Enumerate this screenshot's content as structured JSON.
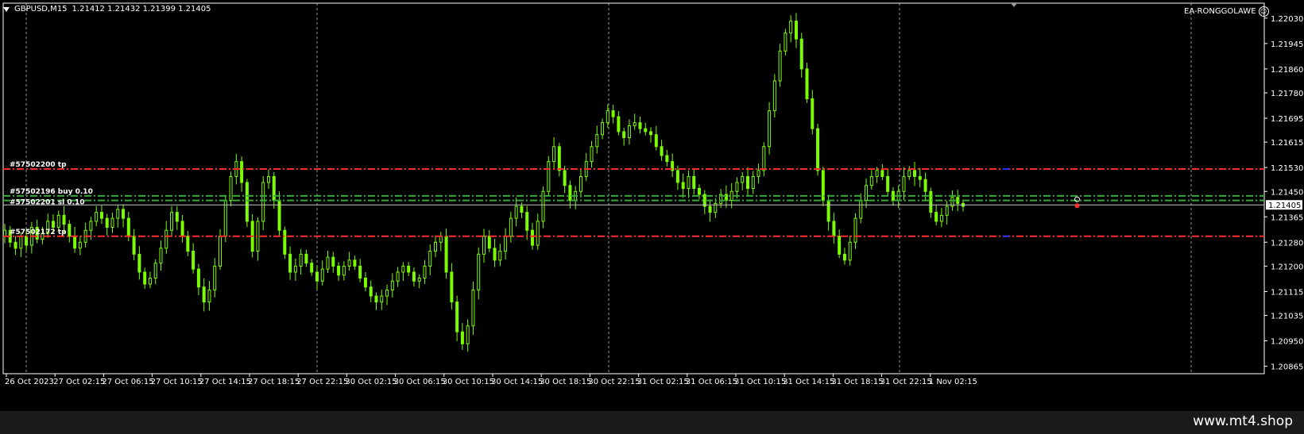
{
  "header": {
    "symbol": "GBPUSD,M15",
    "ohlc": "1.21412 1.21432 1.21399 1.21405",
    "ea_name": "EA-RONGGOLAWE",
    "ea_icon": "smiley-icon"
  },
  "footer": {
    "brand": "www.mt4.shop"
  },
  "colors": {
    "background": "#000000",
    "candle": "#7CFC00",
    "grid": "#c0c0c0",
    "tp_line": "#ff2a2a",
    "order_line": "#3aa83a",
    "current_price_line": "#c8c8c8",
    "axis_text": "#ffffff"
  },
  "chart_data": {
    "type": "candlestick",
    "ylim": [
      1.2084,
      1.2208
    ],
    "y_ticks": [
      "1.22030",
      "1.21945",
      "1.21860",
      "1.21780",
      "1.21695",
      "1.21615",
      "1.21530",
      "1.21450",
      "1.21365",
      "1.21280",
      "1.21200",
      "1.21115",
      "1.21035",
      "1.20950",
      "1.20865"
    ],
    "current_price": "1.21405",
    "x_ticks": [
      "26 Oct 2023",
      "27 Oct 02:15",
      "27 Oct 06:15",
      "27 Oct 10:15",
      "27 Oct 14:15",
      "27 Oct 18:15",
      "27 Oct 22:15",
      "30 Oct 02:15",
      "30 Oct 06:15",
      "30 Oct 10:15",
      "30 Oct 14:15",
      "30 Oct 18:15",
      "30 Oct 22:15",
      "31 Oct 02:15",
      "31 Oct 06:15",
      "31 Oct 10:15",
      "31 Oct 14:15",
      "31 Oct 18:15",
      "31 Oct 22:15",
      "1 Nov 02:15"
    ],
    "horizontal_lines": [
      {
        "price": 1.21525,
        "kind": "tp",
        "label": "#57502200 tp"
      },
      {
        "price": 1.21435,
        "kind": "order",
        "label": "#57502196 buy 0.10"
      },
      {
        "price": 1.2142,
        "kind": "order",
        "label": "#57502201 sl 0.10"
      },
      {
        "price": 1.213,
        "kind": "tp",
        "label": "#57502172 tp"
      }
    ],
    "close_path": [
      1.2132,
      1.2128,
      1.2126,
      1.213,
      1.2127,
      1.2133,
      1.2129,
      1.2131,
      1.2135,
      1.2133,
      1.2137,
      1.2134,
      1.213,
      1.2126,
      1.2128,
      1.2132,
      1.2135,
      1.2138,
      1.2136,
      1.2133,
      1.2136,
      1.2139,
      1.2136,
      1.213,
      1.2124,
      1.2118,
      1.2114,
      1.2116,
      1.2121,
      1.2126,
      1.2132,
      1.2138,
      1.2135,
      1.213,
      1.2125,
      1.2119,
      1.2113,
      1.2108,
      1.2112,
      1.212,
      1.213,
      1.2142,
      1.215,
      1.2155,
      1.2148,
      1.2135,
      1.2125,
      1.2135,
      1.2148,
      1.215,
      1.2142,
      1.2132,
      1.2124,
      1.2118,
      1.212,
      1.2124,
      1.2121,
      1.2118,
      1.2115,
      1.2119,
      1.2123,
      1.212,
      1.2117,
      1.212,
      1.2122,
      1.212,
      1.2116,
      1.2113,
      1.211,
      1.2108,
      1.211,
      1.2112,
      1.2115,
      1.2118,
      1.212,
      1.2118,
      1.2115,
      1.2116,
      1.212,
      1.2125,
      1.2128,
      1.213,
      1.2118,
      1.2108,
      1.2098,
      1.2094,
      1.21,
      1.2112,
      1.2124,
      1.213,
      1.2126,
      1.2122,
      1.2125,
      1.213,
      1.2136,
      1.214,
      1.2138,
      1.2132,
      1.2127,
      1.2135,
      1.2145,
      1.2155,
      1.216,
      1.2152,
      1.2147,
      1.2142,
      1.2145,
      1.215,
      1.2155,
      1.216,
      1.2164,
      1.2168,
      1.2172,
      1.217,
      1.2165,
      1.2163,
      1.2167,
      1.2168,
      1.2166,
      1.2165,
      1.2164,
      1.216,
      1.2157,
      1.2155,
      1.2152,
      1.2148,
      1.2146,
      1.215,
      1.2146,
      1.2144,
      1.214,
      1.2138,
      1.2141,
      1.2144,
      1.2142,
      1.2145,
      1.2148,
      1.215,
      1.2146,
      1.215,
      1.2152,
      1.216,
      1.2172,
      1.2182,
      1.2192,
      1.2198,
      1.2202,
      1.2196,
      1.2186,
      1.2176,
      1.2166,
      1.2152,
      1.2142,
      1.2135,
      1.213,
      1.2124,
      1.2122,
      1.2128,
      1.2136,
      1.2142,
      1.2147,
      1.215,
      1.2152,
      1.215,
      1.2145,
      1.2142,
      1.2145,
      1.215,
      1.2152,
      1.215,
      1.2149,
      1.2145,
      1.2138,
      1.2135,
      1.2137,
      1.214,
      1.2143,
      1.2141,
      1.214
    ],
    "ea_marker": {
      "index": 198,
      "price": 1.21405
    }
  }
}
